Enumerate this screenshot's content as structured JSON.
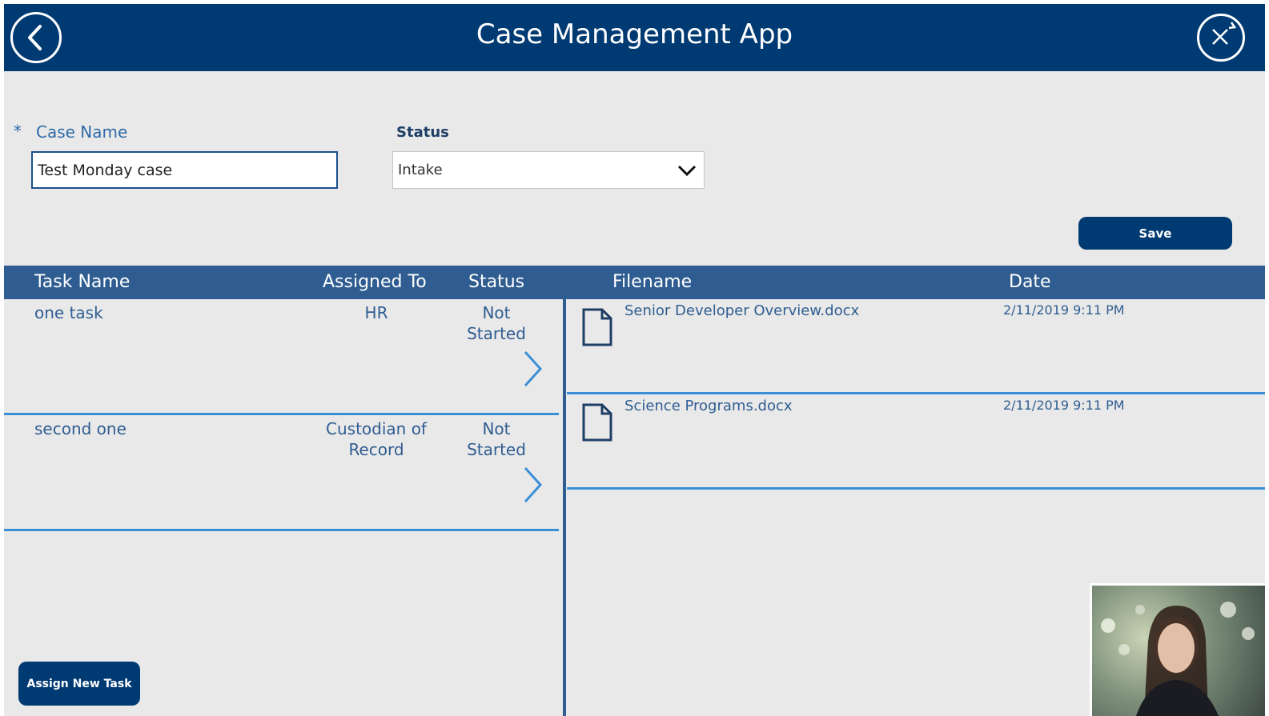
{
  "header": {
    "title": "Case Management App",
    "back_icon": "chevron-left-icon",
    "refresh_icon": "refresh-close-icon"
  },
  "form": {
    "case_name_required_marker": "*",
    "case_name_label": "Case Name",
    "case_name_value": "Test Monday case",
    "status_label": "Status",
    "status_value": "Intake",
    "save_label": "Save"
  },
  "grid": {
    "headers": {
      "task_name": "Task Name",
      "assigned_to": "Assigned To",
      "status": "Status",
      "filename": "Filename",
      "date": "Date"
    },
    "tasks": [
      {
        "name": "one task",
        "assigned": "HR",
        "status": "Not Started"
      },
      {
        "name": "second one",
        "assigned": "Custodian of Record",
        "status": "Not Started"
      }
    ],
    "files": [
      {
        "filename": "Senior Developer Overview.docx",
        "date": "2/11/2019 9:11 PM"
      },
      {
        "filename": "Science Programs.docx",
        "date": "2/11/2019 9:11 PM"
      }
    ]
  },
  "footer": {
    "assign_label": "Assign New Task"
  },
  "colors": {
    "brand": "#003a73",
    "header_row": "#2f5d91",
    "accent_line": "#3a8fd6",
    "background": "#e9e9e9"
  }
}
